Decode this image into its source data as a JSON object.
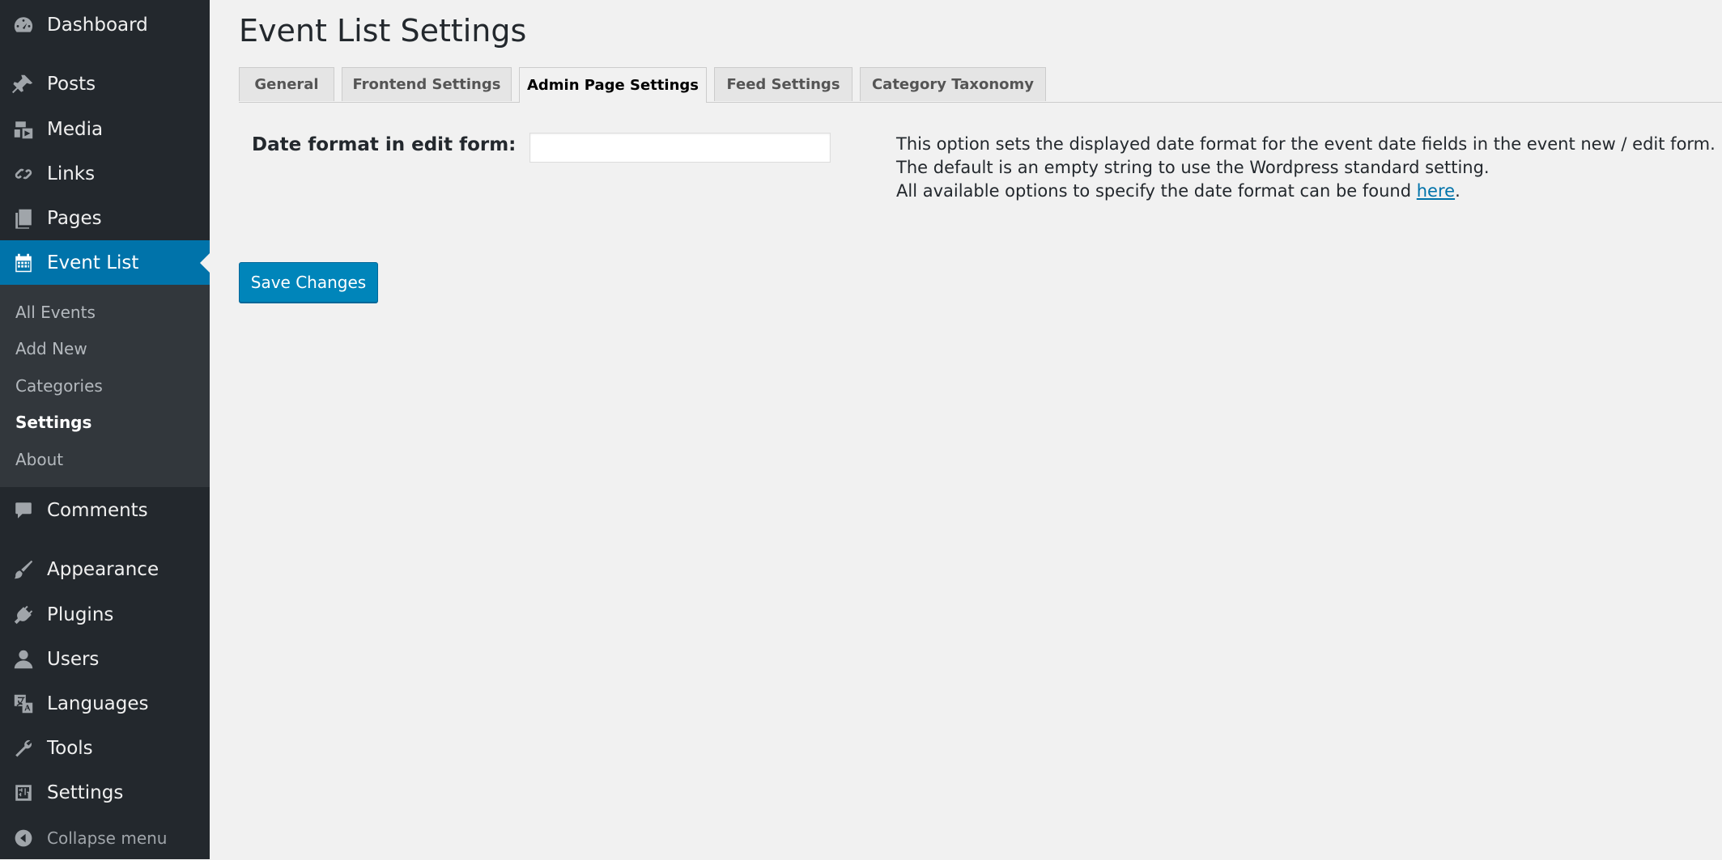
{
  "sidebar": {
    "items": [
      {
        "label": "Dashboard",
        "icon": "dashboard-icon"
      },
      {
        "label": "Posts",
        "icon": "pin-icon"
      },
      {
        "label": "Media",
        "icon": "media-icon"
      },
      {
        "label": "Links",
        "icon": "link-icon"
      },
      {
        "label": "Pages",
        "icon": "pages-icon"
      },
      {
        "label": "Event List",
        "icon": "calendar-icon"
      },
      {
        "label": "Comments",
        "icon": "comment-icon"
      },
      {
        "label": "Appearance",
        "icon": "brush-icon"
      },
      {
        "label": "Plugins",
        "icon": "plug-icon"
      },
      {
        "label": "Users",
        "icon": "user-icon"
      },
      {
        "label": "Languages",
        "icon": "translate-icon"
      },
      {
        "label": "Tools",
        "icon": "wrench-icon"
      },
      {
        "label": "Settings",
        "icon": "sliders-icon"
      }
    ],
    "submenu": [
      "All Events",
      "Add New",
      "Categories",
      "Settings",
      "About"
    ],
    "collapse_label": "Collapse menu",
    "accent_color": "#0073aa"
  },
  "page": {
    "title": "Event List Settings",
    "tabs": [
      "General",
      "Frontend Settings",
      "Admin Page Settings",
      "Feed Settings",
      "Category Taxonomy"
    ],
    "active_tab": "Admin Page Settings"
  },
  "form": {
    "field_label": "Date format in edit form:",
    "field_value": "",
    "desc_line1": "This option sets the displayed date format for the event date fields in the event new / edit form.",
    "desc_line2": "The default is an empty string to use the Wordpress standard setting.",
    "desc_line3_prefix": "All available options to specify the date format can be found ",
    "desc_link": "here",
    "desc_line3_suffix": "."
  },
  "actions": {
    "save_label": "Save Changes"
  }
}
